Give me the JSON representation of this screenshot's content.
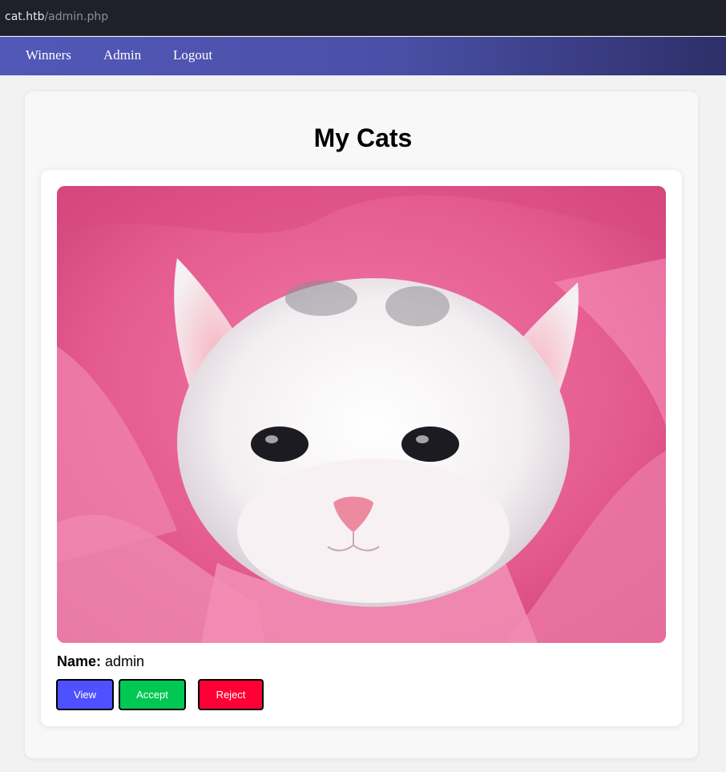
{
  "browser": {
    "url_host": "cat.htb",
    "url_path": "/admin.php"
  },
  "nav": {
    "items": [
      {
        "label": "Winners"
      },
      {
        "label": "Admin"
      },
      {
        "label": "Logout"
      }
    ],
    "gradient_colors": [
      "#5258b8",
      "#2d2f69"
    ]
  },
  "main": {
    "title": "My Cats",
    "cat": {
      "image_icon": "kitten-photo",
      "name_label": "Name:",
      "name_value": "admin",
      "buttons": {
        "view": {
          "label": "View",
          "color": "#4f50ff"
        },
        "accept": {
          "label": "Accept",
          "color": "#00c853"
        },
        "reject": {
          "label": "Reject",
          "color": "#ff0036"
        }
      }
    }
  }
}
